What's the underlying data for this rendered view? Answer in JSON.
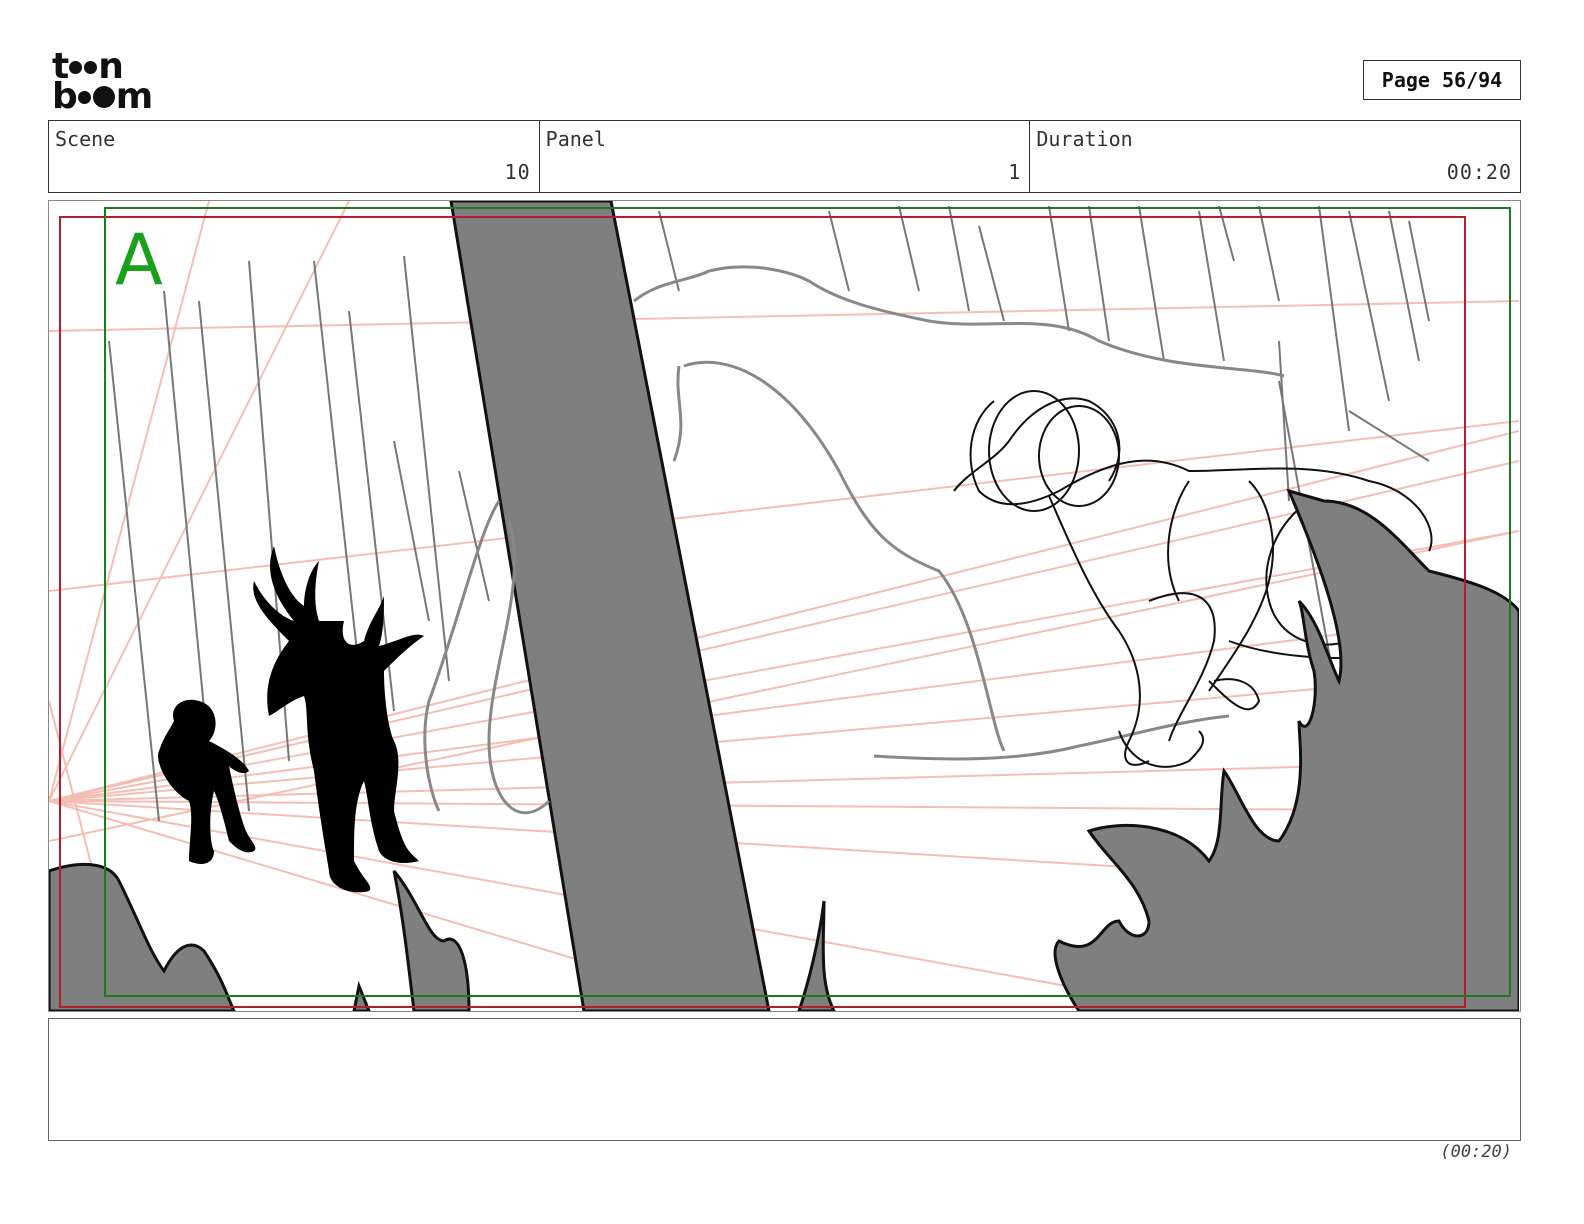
{
  "logo": {
    "line1": "t",
    "line1_end": "n",
    "line2": "b",
    "line2_end": "m",
    "wordmark": "toon boom",
    "icon": "toon-boom-logo"
  },
  "page": {
    "label": "Page",
    "number": "56/94"
  },
  "info": {
    "scene_label": "Scene",
    "scene_value": "10",
    "panel_label": "Panel",
    "panel_value": "1",
    "duration_label": "Duration",
    "duration_value": "00:20"
  },
  "panel": {
    "field_guide_label": "A"
  },
  "notes": {
    "text": ""
  },
  "footer": {
    "duration": "(00:20)"
  },
  "colors": {
    "safe_frame": "#1f7a1f",
    "camera_frame": "#b0202a",
    "perspective_lines": "#f4b8ac",
    "shadow_fill": "#7f7f7f",
    "field_label": "#1aa01a"
  }
}
